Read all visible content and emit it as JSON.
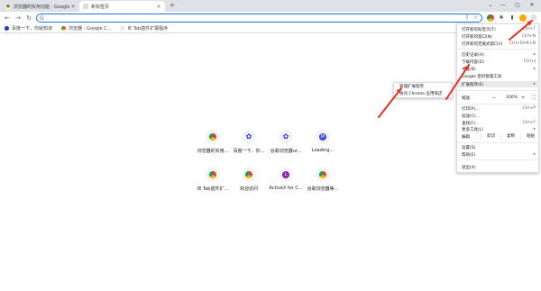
{
  "tabs": [
    {
      "title": "浏览器的实用功能 - Google Chr...",
      "close": "×"
    },
    {
      "title": "新标签页",
      "close": "×"
    }
  ],
  "newtab_label": "+",
  "window_controls": [
    "⌄",
    "—",
    "▢",
    "✕"
  ],
  "toolbar": {
    "back": "←",
    "forward": "→",
    "reload": "↻",
    "omnibox_icon": "G",
    "omnibox_actions": [
      "⇪",
      "☆"
    ],
    "kebab": "⋮"
  },
  "bookmarks": [
    {
      "label": "百度一下，你就知道",
      "icon": "baidu-paw-icon"
    },
    {
      "label": "浏览器 - Google C...",
      "icon": "chrome-icon"
    },
    {
      "label": "IE Tab插件扩展程序",
      "icon": "ie-tab-icon"
    }
  ],
  "shortcuts": [
    {
      "label": "浏览器的实用...",
      "icon": "chrome-icon",
      "glyph": ""
    },
    {
      "label": "百度一下，你...",
      "icon": "baidu-paw-icon",
      "glyph": "✿"
    },
    {
      "label": "谷歌浏览器ur...",
      "icon": "baidu-paw-icon",
      "glyph": "✿"
    },
    {
      "label": "Loading...",
      "icon": "ie-icon",
      "glyph": "IP"
    },
    {
      "label": "IE Tab插件扩...",
      "icon": "chrome-icon",
      "glyph": ""
    },
    {
      "label": "欢迎访问",
      "icon": "chrome-icon",
      "glyph": ""
    },
    {
      "label": "ActiveX for C...",
      "icon": "activex-icon",
      "glyph": "L"
    },
    {
      "label": "谷歌浏览器等...",
      "icon": "chrome-icon",
      "glyph": ""
    }
  ],
  "menu": {
    "new_tab": {
      "label": "打开新的标签页(T)",
      "key": "Ctrl+T"
    },
    "new_window": {
      "label": "打开新的窗口(N)",
      "key": "Ctrl+N"
    },
    "incognito": {
      "label": "打开新的无痕式窗口(I)",
      "key": "Ctrl+Shift+N"
    },
    "history": {
      "label": "历史记录(H)",
      "key": "▸"
    },
    "downloads": {
      "label": "下载内容(D)",
      "key": "Ctrl+J"
    },
    "bookmarks": {
      "label": "书签(B)",
      "key": "▸"
    },
    "google_password": {
      "label": "Google 密码管理工具",
      "key": ""
    },
    "extensions": {
      "label": "扩展程序(E)",
      "key": "▸"
    },
    "zoom_label": "缩放",
    "zoom_minus": "−",
    "zoom_value": "100%",
    "zoom_plus": "+",
    "zoom_fullscreen": "⛶",
    "print": {
      "label": "打印(P)...",
      "key": "Ctrl+P"
    },
    "cast": {
      "label": "投放(C)...",
      "key": ""
    },
    "find": {
      "label": "查找(F)...",
      "key": "Ctrl+F"
    },
    "more_tools": {
      "label": "更多工具(L)",
      "key": "▸"
    },
    "edit_label": "编辑",
    "cut": "剪切",
    "copy": "复制",
    "paste": "粘贴",
    "settings": {
      "label": "设置(S)",
      "key": ""
    },
    "help": {
      "label": "帮助(E)",
      "key": "▸"
    },
    "exit": {
      "label": "退出(X)",
      "key": ""
    }
  },
  "submenu": {
    "manage": "管理扩展程序",
    "store": "访问 Chrome 应用商店"
  },
  "colors": {
    "accent": "#1a73e8",
    "annotation": "#e8321e"
  }
}
